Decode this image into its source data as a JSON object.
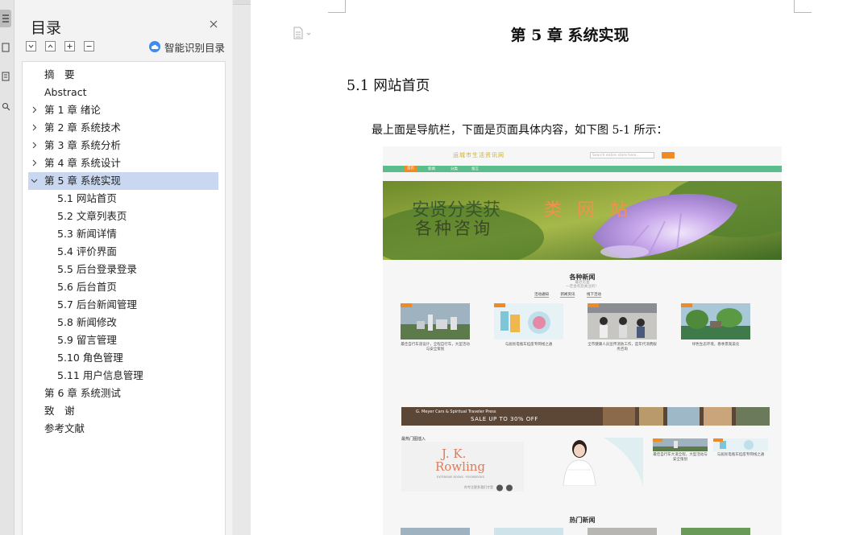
{
  "toc": {
    "title": "目录",
    "smart_label": "智能识别目录",
    "items": [
      {
        "label": "摘　要",
        "level": 1,
        "expandable": false,
        "selected": false
      },
      {
        "label": "Abstract",
        "level": 1,
        "expandable": false,
        "selected": false
      },
      {
        "label": "第 1 章  绪论",
        "level": 1,
        "expandable": true,
        "selected": false
      },
      {
        "label": "第 2 章  系统技术",
        "level": 1,
        "expandable": true,
        "selected": false
      },
      {
        "label": "第 3 章  系统分析",
        "level": 1,
        "expandable": true,
        "selected": false
      },
      {
        "label": "第 4 章  系统设计",
        "level": 1,
        "expandable": true,
        "selected": false
      },
      {
        "label": "第 5 章  系统实现",
        "level": 1,
        "expandable": true,
        "expanded": true,
        "selected": true
      },
      {
        "label": "5.1 网站首页",
        "level": 2
      },
      {
        "label": "5.2 文章列表页",
        "level": 2
      },
      {
        "label": "5.3 新闻详情",
        "level": 2
      },
      {
        "label": "5.4 评价界面",
        "level": 2
      },
      {
        "label": "5.5 后台登录登录",
        "level": 2
      },
      {
        "label": "5.6 后台首页",
        "level": 2
      },
      {
        "label": "5.7 后台新闻管理",
        "level": 2
      },
      {
        "label": "5.8 新闻修改",
        "level": 2
      },
      {
        "label": "5.9 留言管理",
        "level": 2
      },
      {
        "label": "5.10 角色管理",
        "level": 2
      },
      {
        "label": "5.11 用户信息管理",
        "level": 2
      },
      {
        "label": "第 6 章  系统测试",
        "level": 1,
        "expandable": false
      },
      {
        "label": "致　谢",
        "level": 1,
        "expandable": false
      },
      {
        "label": "参考文献",
        "level": 1,
        "expandable": false
      }
    ]
  },
  "document": {
    "chapter_title": "第 5 章  系统实现",
    "section_title": "5.1 网站首页",
    "paragraph": "最上面是导航栏，下面是页面具体内容，如下图 5-1 所示："
  },
  "figure": {
    "logo_text": "运城市生活资讯网",
    "search_placeholder": "Search entire store here...",
    "nav_items": [
      "首页",
      "新闻",
      "分类",
      "留言"
    ],
    "banner_line1": "安贤分类获",
    "banner_line2": "类 网 站",
    "banner_line3": "各种咨询",
    "section1_title": "各种新闻",
    "section1_sub1": "最近可查",
    "section1_sub2": "一定会有您关注的！",
    "tabs": [
      "活动通知",
      "新闻资讯",
      "线下活动"
    ],
    "cards": [
      {
        "caption": "最佳自行车道设计，全程自行车，大型活动与安全策划"
      },
      {
        "caption": "与居民电瓶车挂座专网线之通"
      },
      {
        "caption": "全市健康人员宣传消防工作，是年代消费服务咨询"
      },
      {
        "caption": "绿色生态环境，春季景观美化"
      }
    ],
    "ad_line1": "G. Meyer Cars & Spiritual Traveler Press",
    "ad_line2": "SALE UP TO 30% OFF",
    "hot_label": "最热门图插入",
    "jk_line1": "J. K.",
    "jk_line2": "Rowling",
    "jk_line3": "EXTENSIVE BOOKS · ROOKBOOKS",
    "jk_line4": "你专注更多我们才是",
    "side_captions": [
      "最佳自行车大道全程，大型活动与安全策划",
      "与居民电瓶车挂座专网线之通"
    ],
    "section2_title": "热门新闻"
  }
}
